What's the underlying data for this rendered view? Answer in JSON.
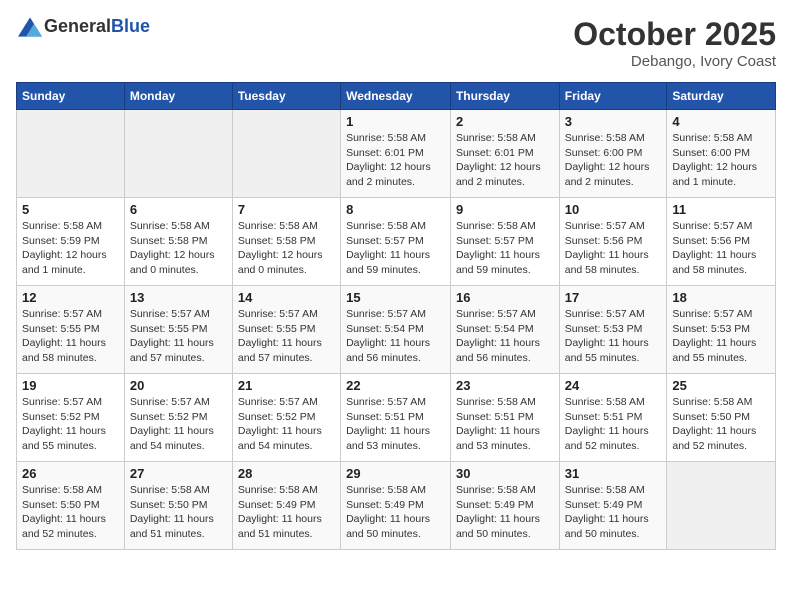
{
  "header": {
    "logo_general": "General",
    "logo_blue": "Blue",
    "month": "October 2025",
    "location": "Debango, Ivory Coast"
  },
  "weekdays": [
    "Sunday",
    "Monday",
    "Tuesday",
    "Wednesday",
    "Thursday",
    "Friday",
    "Saturday"
  ],
  "weeks": [
    [
      {
        "day": "",
        "info": ""
      },
      {
        "day": "",
        "info": ""
      },
      {
        "day": "",
        "info": ""
      },
      {
        "day": "1",
        "info": "Sunrise: 5:58 AM\nSunset: 6:01 PM\nDaylight: 12 hours and 2 minutes."
      },
      {
        "day": "2",
        "info": "Sunrise: 5:58 AM\nSunset: 6:01 PM\nDaylight: 12 hours and 2 minutes."
      },
      {
        "day": "3",
        "info": "Sunrise: 5:58 AM\nSunset: 6:00 PM\nDaylight: 12 hours and 2 minutes."
      },
      {
        "day": "4",
        "info": "Sunrise: 5:58 AM\nSunset: 6:00 PM\nDaylight: 12 hours and 1 minute."
      }
    ],
    [
      {
        "day": "5",
        "info": "Sunrise: 5:58 AM\nSunset: 5:59 PM\nDaylight: 12 hours and 1 minute."
      },
      {
        "day": "6",
        "info": "Sunrise: 5:58 AM\nSunset: 5:58 PM\nDaylight: 12 hours and 0 minutes."
      },
      {
        "day": "7",
        "info": "Sunrise: 5:58 AM\nSunset: 5:58 PM\nDaylight: 12 hours and 0 minutes."
      },
      {
        "day": "8",
        "info": "Sunrise: 5:58 AM\nSunset: 5:57 PM\nDaylight: 11 hours and 59 minutes."
      },
      {
        "day": "9",
        "info": "Sunrise: 5:58 AM\nSunset: 5:57 PM\nDaylight: 11 hours and 59 minutes."
      },
      {
        "day": "10",
        "info": "Sunrise: 5:57 AM\nSunset: 5:56 PM\nDaylight: 11 hours and 58 minutes."
      },
      {
        "day": "11",
        "info": "Sunrise: 5:57 AM\nSunset: 5:56 PM\nDaylight: 11 hours and 58 minutes."
      }
    ],
    [
      {
        "day": "12",
        "info": "Sunrise: 5:57 AM\nSunset: 5:55 PM\nDaylight: 11 hours and 58 minutes."
      },
      {
        "day": "13",
        "info": "Sunrise: 5:57 AM\nSunset: 5:55 PM\nDaylight: 11 hours and 57 minutes."
      },
      {
        "day": "14",
        "info": "Sunrise: 5:57 AM\nSunset: 5:55 PM\nDaylight: 11 hours and 57 minutes."
      },
      {
        "day": "15",
        "info": "Sunrise: 5:57 AM\nSunset: 5:54 PM\nDaylight: 11 hours and 56 minutes."
      },
      {
        "day": "16",
        "info": "Sunrise: 5:57 AM\nSunset: 5:54 PM\nDaylight: 11 hours and 56 minutes."
      },
      {
        "day": "17",
        "info": "Sunrise: 5:57 AM\nSunset: 5:53 PM\nDaylight: 11 hours and 55 minutes."
      },
      {
        "day": "18",
        "info": "Sunrise: 5:57 AM\nSunset: 5:53 PM\nDaylight: 11 hours and 55 minutes."
      }
    ],
    [
      {
        "day": "19",
        "info": "Sunrise: 5:57 AM\nSunset: 5:52 PM\nDaylight: 11 hours and 55 minutes."
      },
      {
        "day": "20",
        "info": "Sunrise: 5:57 AM\nSunset: 5:52 PM\nDaylight: 11 hours and 54 minutes."
      },
      {
        "day": "21",
        "info": "Sunrise: 5:57 AM\nSunset: 5:52 PM\nDaylight: 11 hours and 54 minutes."
      },
      {
        "day": "22",
        "info": "Sunrise: 5:57 AM\nSunset: 5:51 PM\nDaylight: 11 hours and 53 minutes."
      },
      {
        "day": "23",
        "info": "Sunrise: 5:58 AM\nSunset: 5:51 PM\nDaylight: 11 hours and 53 minutes."
      },
      {
        "day": "24",
        "info": "Sunrise: 5:58 AM\nSunset: 5:51 PM\nDaylight: 11 hours and 52 minutes."
      },
      {
        "day": "25",
        "info": "Sunrise: 5:58 AM\nSunset: 5:50 PM\nDaylight: 11 hours and 52 minutes."
      }
    ],
    [
      {
        "day": "26",
        "info": "Sunrise: 5:58 AM\nSunset: 5:50 PM\nDaylight: 11 hours and 52 minutes."
      },
      {
        "day": "27",
        "info": "Sunrise: 5:58 AM\nSunset: 5:50 PM\nDaylight: 11 hours and 51 minutes."
      },
      {
        "day": "28",
        "info": "Sunrise: 5:58 AM\nSunset: 5:49 PM\nDaylight: 11 hours and 51 minutes."
      },
      {
        "day": "29",
        "info": "Sunrise: 5:58 AM\nSunset: 5:49 PM\nDaylight: 11 hours and 50 minutes."
      },
      {
        "day": "30",
        "info": "Sunrise: 5:58 AM\nSunset: 5:49 PM\nDaylight: 11 hours and 50 minutes."
      },
      {
        "day": "31",
        "info": "Sunrise: 5:58 AM\nSunset: 5:49 PM\nDaylight: 11 hours and 50 minutes."
      },
      {
        "day": "",
        "info": ""
      }
    ]
  ]
}
